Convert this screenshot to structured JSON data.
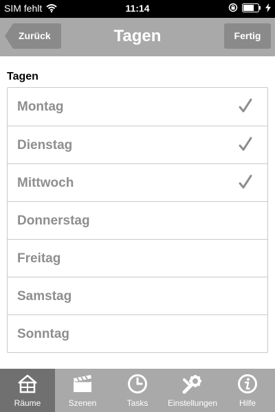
{
  "status_bar": {
    "carrier": "SIM fehlt",
    "time": "11:14"
  },
  "nav": {
    "title": "Tagen",
    "back_label": "Zurück",
    "done_label": "Fertig"
  },
  "section_title": "Tagen",
  "days": [
    {
      "label": "Montag",
      "checked": true
    },
    {
      "label": "Dienstag",
      "checked": true
    },
    {
      "label": "Mittwoch",
      "checked": true
    },
    {
      "label": "Donnerstag",
      "checked": false
    },
    {
      "label": "Freitag",
      "checked": false
    },
    {
      "label": "Samstag",
      "checked": false
    },
    {
      "label": "Sonntag",
      "checked": false
    }
  ],
  "tabs": [
    {
      "label": "Räume",
      "icon": "house-icon",
      "selected": true
    },
    {
      "label": "Szenen",
      "icon": "clapperboard-icon",
      "selected": false
    },
    {
      "label": "Tasks",
      "icon": "clock-icon",
      "selected": false
    },
    {
      "label": "Einstellungen",
      "icon": "wrench-gear-icon",
      "selected": false
    },
    {
      "label": "Hilfe",
      "icon": "info-icon",
      "selected": false
    }
  ],
  "colors": {
    "bar": "#a9a9a9",
    "selected_tab": "#707070",
    "day_text": "#8e8e8e",
    "check": "#8e8e8e"
  }
}
